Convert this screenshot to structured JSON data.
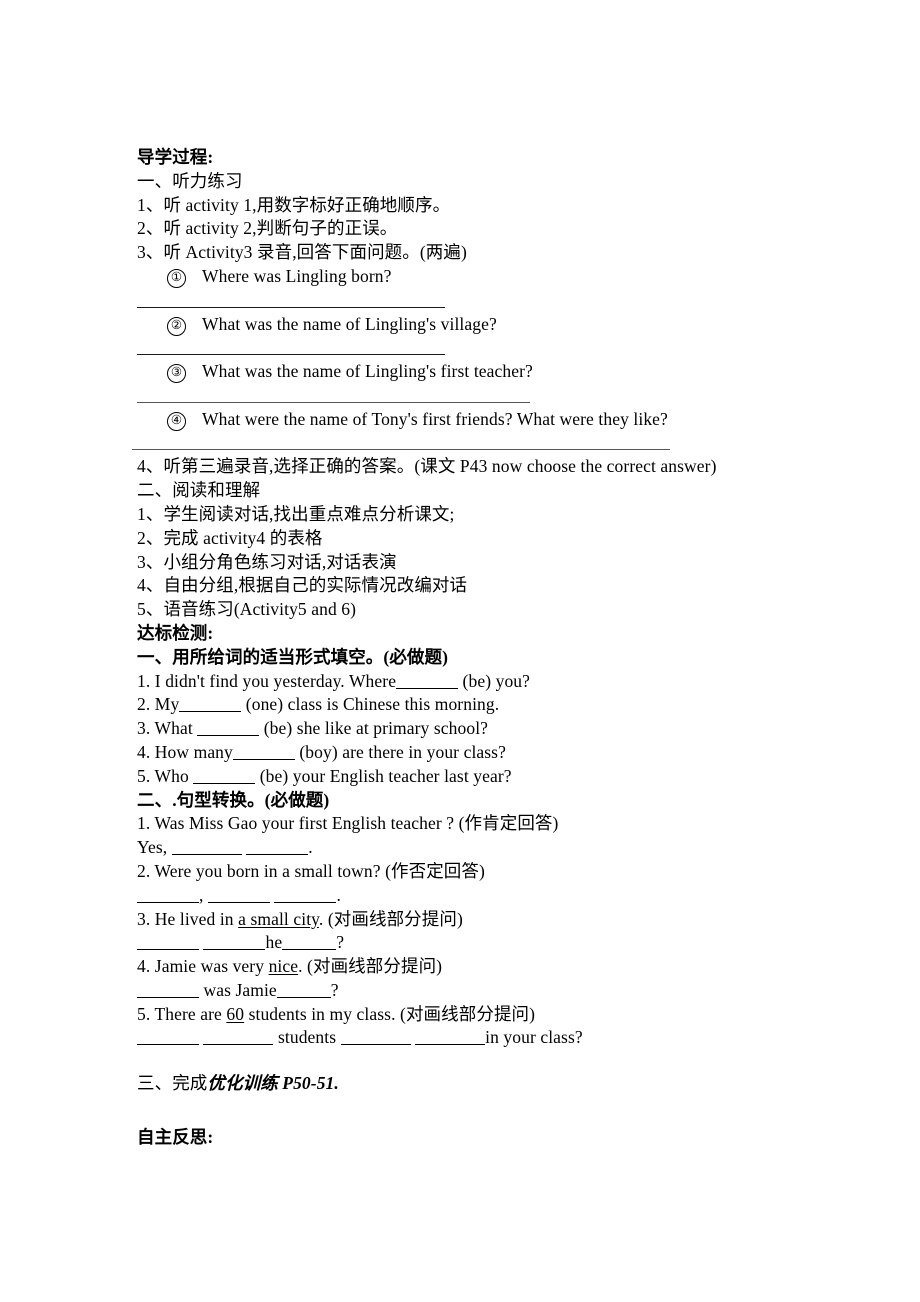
{
  "document": {
    "sections": {
      "guide_heading": "导学过程:",
      "part_one_heading": "一、听力练习",
      "listening_items": [
        "1、听 activity 1,用数字标好正确地顺序。",
        "2、听 activity 2,判断句子的正误。",
        "3、听 Activity3 录音,回答下面问题。(两遍)"
      ],
      "listening_questions": [
        {
          "num": "①",
          "text": "Where was Lingling born?"
        },
        {
          "num": "②",
          "text": "What was the name of Lingling's village?"
        },
        {
          "num": "③",
          "text": "What was the name of Lingling's first teacher?"
        },
        {
          "num": "④",
          "text": "What were the name of Tony's first friends? What were they like?"
        }
      ],
      "listening_item_4": "4、听第三遍录音,选择正确的答案。(课文 P43 now choose the correct answer)",
      "part_two_heading": "二、阅读和理解",
      "reading_items": [
        "1、学生阅读对话,找出重点难点分析课文;",
        "2、完成 activity4 的表格",
        "3、小组分角色练习对话,对话表演",
        "4、自由分组,根据自己的实际情况改编对话",
        "5、语音练习(Activity5 and 6)"
      ],
      "test_heading": "达标检测:",
      "exercise_one_heading": "一、用所给词的适当形式填空。(必做题)",
      "exercise_one_items": [
        {
          "pre": "1. I didn't find you yesterday. Where",
          "blank": "b6",
          "post": " (be) you?"
        },
        {
          "pre": "2. My",
          "blank": "b6",
          "post": " (one) class is Chinese this morning."
        },
        {
          "pre": "3. What ",
          "blank": "b6",
          "post": " (be) she like at primary school?"
        },
        {
          "pre": "4. How many",
          "blank": "b6",
          "post": " (boy) are there in your class?"
        },
        {
          "pre": "5. Who ",
          "blank": "b6",
          "post": " (be) your English teacher last year?"
        }
      ],
      "exercise_two_heading": "二、.句型转换。(必做题)",
      "exercise_two_items": [
        {
          "prompt": "1. Was Miss Gao your first English teacher ? (作肯定回答)",
          "answer_pre": "Yes, ",
          "answer_post": "."
        },
        {
          "prompt": "2. Were you born in a small town? (作否定回答)",
          "answer_pre": "",
          "answer_post": "."
        },
        {
          "prompt_a": "3. He lived in ",
          "prompt_underlined": "a small city",
          "prompt_b": ". (对画线部分提问)",
          "answer_mid": "he",
          "answer_post": "?"
        },
        {
          "prompt_a": "4. Jamie was very ",
          "prompt_underlined": "nice",
          "prompt_b": ". (对画线部分提问)",
          "answer_mid": "was Jamie",
          "answer_post": "?"
        },
        {
          "prompt_a": "5. There are ",
          "prompt_underlined": "60",
          "prompt_b": " students in my class. (对画线部分提问)",
          "answer_mid": "students",
          "answer_post": "in your class?"
        }
      ],
      "exercise_three_prefix": "三、完成",
      "exercise_three_emph": "优化训练 P50-51.",
      "reflection_heading": "自主反思:"
    }
  }
}
